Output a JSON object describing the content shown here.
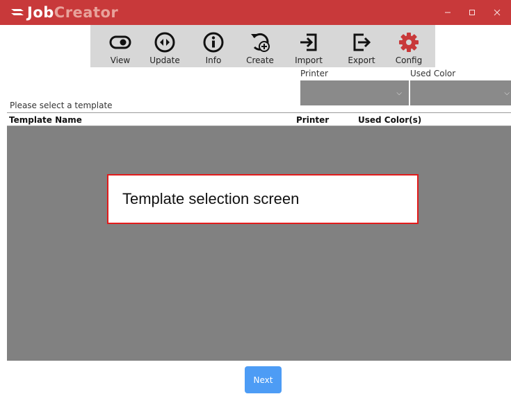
{
  "app": {
    "logo_part1": "Job",
    "logo_part2": "Creator",
    "brand_color": "#c8393a"
  },
  "window_controls": [
    {
      "name": "minimize",
      "glyph": "–"
    },
    {
      "name": "maximize",
      "glyph": "▢"
    },
    {
      "name": "close",
      "glyph": "✕"
    }
  ],
  "toolbar": {
    "items": [
      {
        "label": "View",
        "icon": "toggle-icon"
      },
      {
        "label": "Update",
        "icon": "update-icon"
      },
      {
        "label": "Info",
        "icon": "info-icon"
      },
      {
        "label": "Create",
        "icon": "create-icon"
      },
      {
        "label": "Import",
        "icon": "import-icon"
      },
      {
        "label": "Export",
        "icon": "export-icon"
      },
      {
        "label": "Config",
        "icon": "gear-icon"
      }
    ]
  },
  "filters": {
    "printer_label": "Printer",
    "printer_value": "",
    "color_label": "Used Color",
    "color_value": ""
  },
  "hint": "Please select a template",
  "table": {
    "columns": [
      "Template Name",
      "Printer",
      "Used Color(s)"
    ],
    "rows": []
  },
  "callout": "Template selection screen",
  "footer": {
    "next_label": "Next",
    "accent": "#4d9cf5"
  }
}
